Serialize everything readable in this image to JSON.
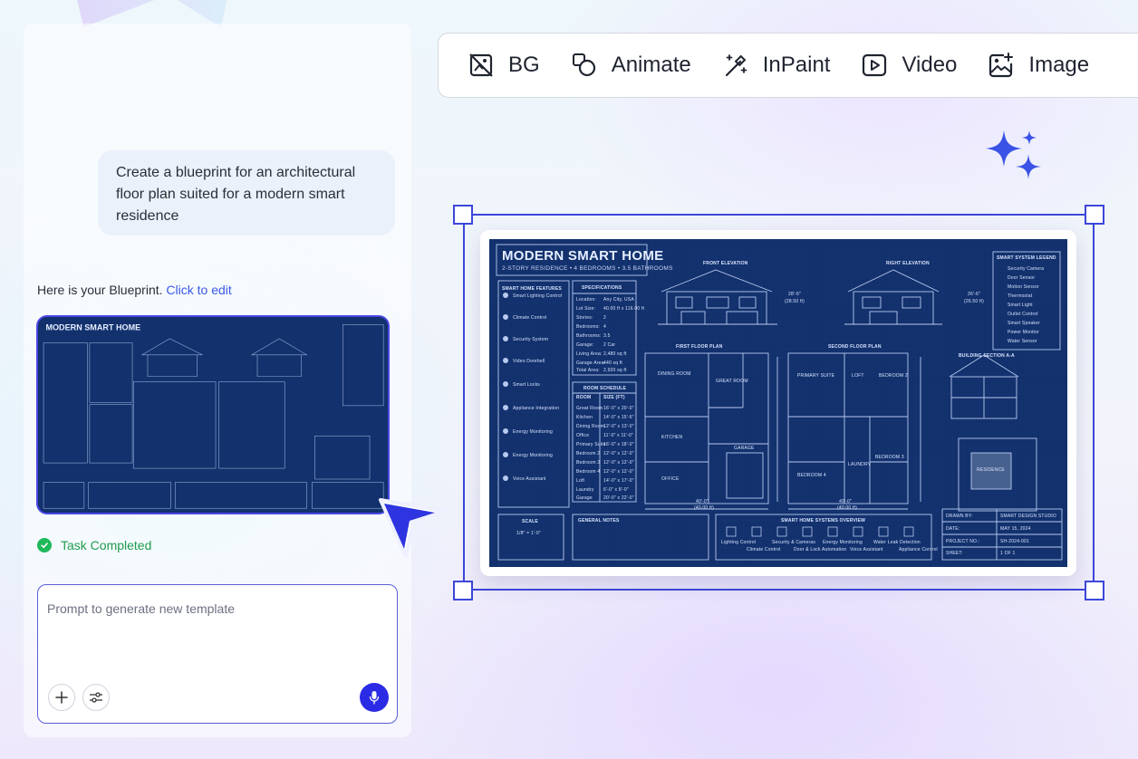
{
  "toolbar": {
    "items": [
      {
        "label": "BG",
        "icon": "bg-remove-icon"
      },
      {
        "label": "Animate",
        "icon": "animate-icon"
      },
      {
        "label": "InPaint",
        "icon": "magic-wand-icon"
      },
      {
        "label": "Video",
        "icon": "video-play-icon"
      },
      {
        "label": "Image",
        "icon": "image-add-icon"
      }
    ]
  },
  "chat": {
    "user_message": "Create a blueprint for an architectural floor plan suited for a modern smart residence",
    "reply_text": "Here is your Blueprint.",
    "reply_link": "Click to edit",
    "status": "Task Completed"
  },
  "prompt": {
    "placeholder": "Prompt to generate new template",
    "value": ""
  },
  "blueprint": {
    "title": "MODERN SMART HOME",
    "subtitle": "2-STORY RESIDENCE • 4 BEDROOMS • 3.5 BATHROOMS",
    "front_elevation": "FRONT ELEVATION",
    "right_elevation": "RIGHT ELEVATION",
    "first_floor": "FIRST FLOOR PLAN",
    "second_floor": "SECOND FLOOR PLAN",
    "section": "BUILDING SECTION A-A",
    "features_title": "SMART HOME FEATURES",
    "specs_title": "SPECIFICATIONS",
    "room_schedule": "ROOM SCHEDULE",
    "legend_title": "SMART SYSTEM LEGEND",
    "scale": "SCALE",
    "scale_value": "1/8\" = 1'-0\"",
    "notes_title": "GENERAL NOTES",
    "overview_title": "SMART HOME SYSTEMS OVERVIEW",
    "features": [
      "Smart Lighting Control",
      "Climate Control",
      "Security System",
      "Video Doorbell",
      "Smart Locks",
      "Appliance Integration",
      "Energy Monitoring",
      "Energy Monitoring",
      "Voice Assistant"
    ],
    "specs": [
      [
        "Location:",
        "Any City, USA"
      ],
      [
        "Lot Size:",
        "40.00 ft x 116.00 ft"
      ],
      [
        "Stories:",
        "2"
      ],
      [
        "Bedrooms:",
        "4"
      ],
      [
        "Bathrooms:",
        "3.5"
      ],
      [
        "Garage:",
        "2 Car"
      ],
      [
        "Living Area:",
        "2,480 sq ft"
      ],
      [
        "Garage Area:",
        "440 sq ft"
      ],
      [
        "Total Area:",
        "2,920 sq ft"
      ]
    ],
    "room_cols": [
      "ROOM",
      "SIZE (FT)"
    ],
    "rooms": [
      [
        "Great Room",
        "16'-0\" x 20'-0\""
      ],
      [
        "Kitchen",
        "14'-0\" x 15'-6\""
      ],
      [
        "Dining Room",
        "12'-0\" x 13'-0\""
      ],
      [
        "Office",
        "11'-0\" x 11'-0\""
      ],
      [
        "Primary Suite",
        "16'-0\" x 18'-0\""
      ],
      [
        "Bedroom 2",
        "12'-0\" x 12'-0\""
      ],
      [
        "Bedroom 3",
        "12'-0\" x 12'-0\""
      ],
      [
        "Bedroom 4",
        "12'-0\" x 12'-0\""
      ],
      [
        "Loft",
        "14'-0\" x 17'-0\""
      ],
      [
        "Laundry",
        "6'-0\" x 8'-0\""
      ],
      [
        "Garage",
        "20'-0\" x 22'-0\""
      ]
    ],
    "legend": [
      "Security Camera",
      "Door Sensor",
      "Motion Sensor",
      "Thermostat",
      "Smart Light",
      "Outlet Control",
      "Smart Speaker",
      "Power Monitor",
      "Water Sensor"
    ],
    "overview": [
      "Lighting Control",
      "Climate Control",
      "Security & Cameras",
      "Door & Lock Automation",
      "Energy Monitoring",
      "Voice Assistant",
      "Water Leak Detection",
      "Appliance Control"
    ],
    "title_block": [
      [
        "DRAWN BY:",
        "SMART DESIGN STUDIO"
      ],
      [
        "DATE:",
        "MAY 15, 2024"
      ],
      [
        "PROJECT NO.:",
        "SH-2024-001"
      ],
      [
        "SHEET:",
        "1 OF 1"
      ]
    ],
    "dim_width": "40'-0\"",
    "dim_width_ft": "(40.00 ft)",
    "dim_height_1": "28'-6\"",
    "dim_height_1_ft": "(28.50 ft)",
    "dim_height_2": "26'-6\"",
    "dim_height_2_ft": "(26.50 ft)",
    "room_labels": [
      "DINING ROOM",
      "GREAT ROOM",
      "KITCHEN",
      "OFFICE",
      "GARAGE",
      "PRIMARY SUITE",
      "LOFT",
      "BEDROOM 2",
      "BEDROOM 3",
      "BEDROOM 4",
      "LAUNDRY",
      "RESIDENCE"
    ]
  },
  "colors": {
    "accent": "#3c47d9",
    "blueprint_bg": "#12316d",
    "success": "#1fb85a",
    "mic": "#2b2be6"
  }
}
